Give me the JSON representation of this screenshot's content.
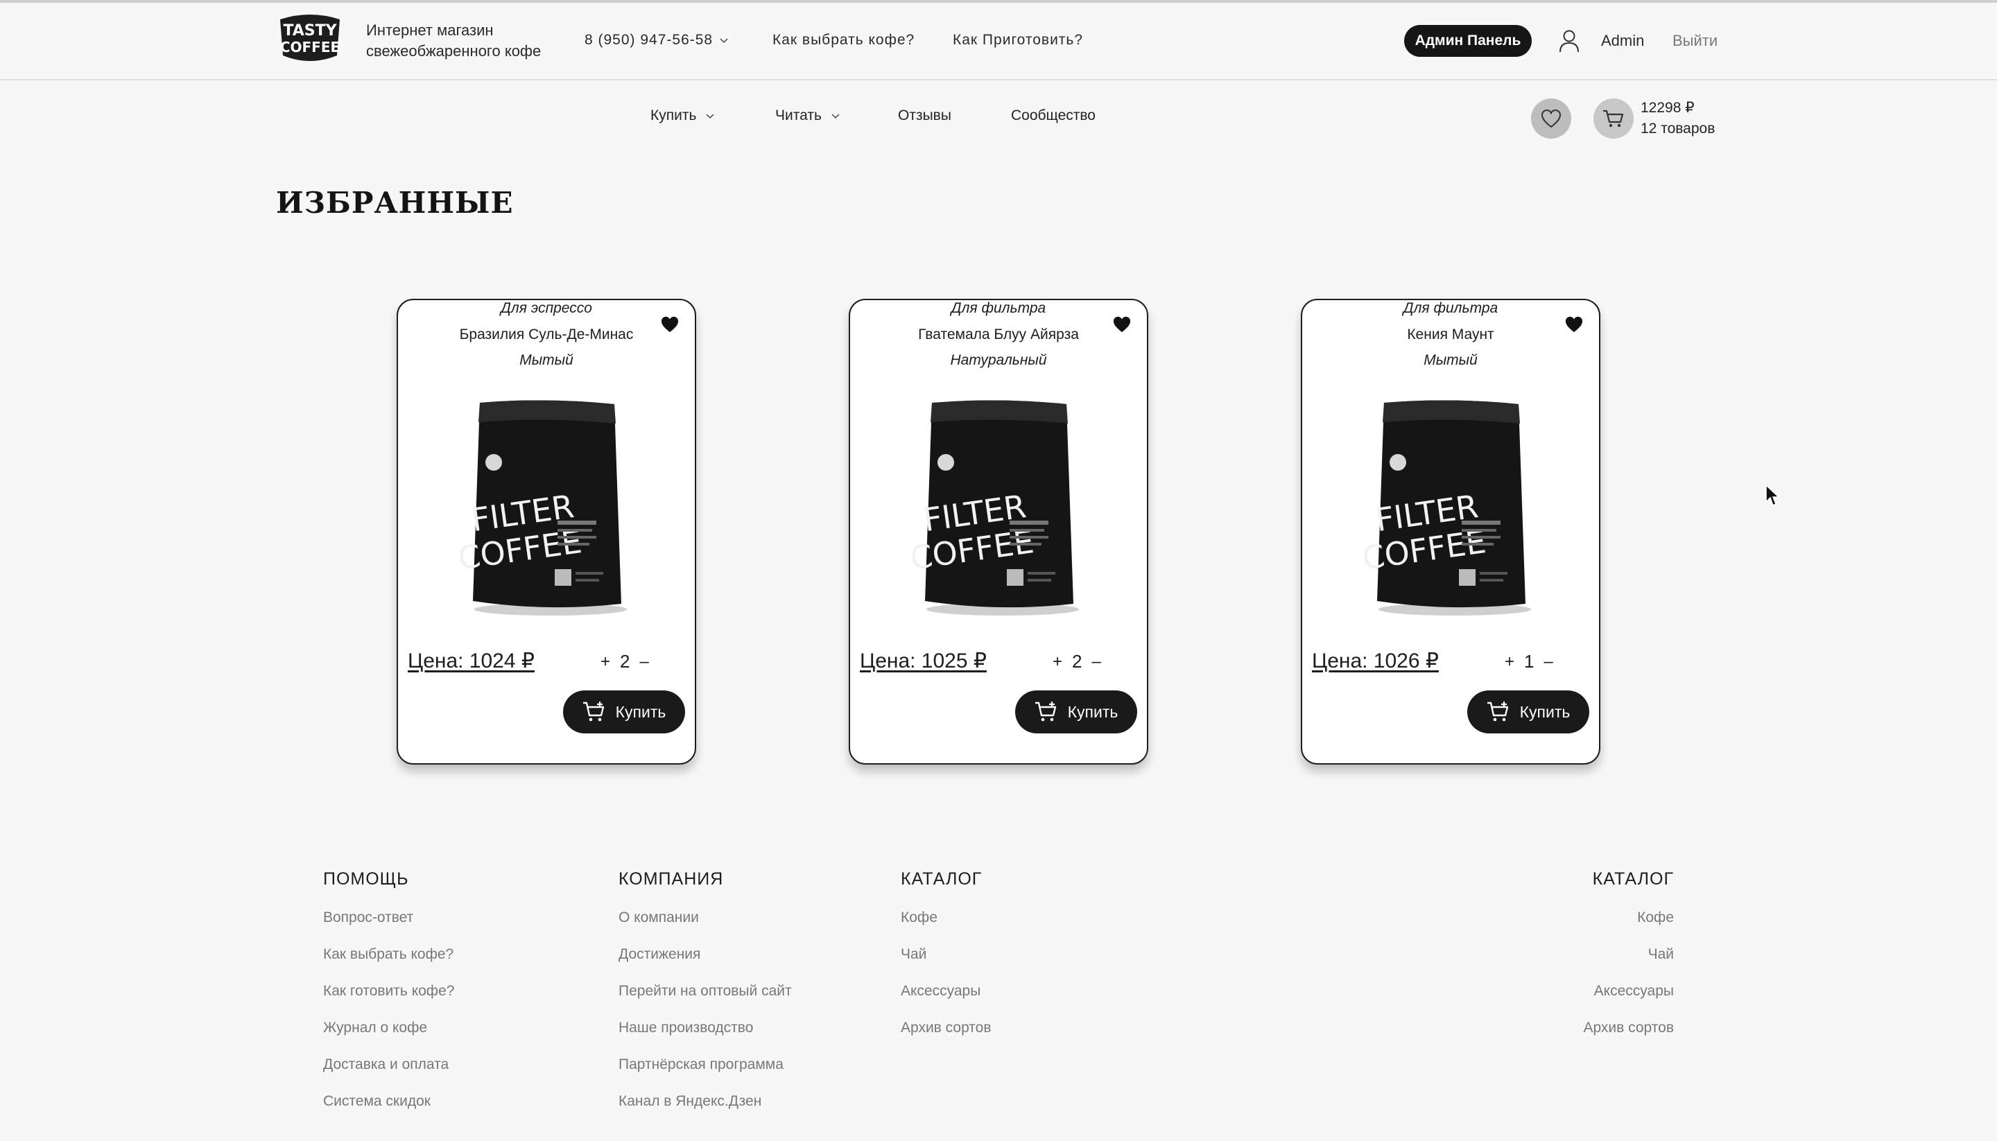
{
  "header": {
    "logo_line1": "TASTY",
    "logo_line2": "COFFEE",
    "tagline_line1": "Интернет магазин",
    "tagline_line2": "свежеобжаренного кофе",
    "phone": "8 (950) 947-56-58",
    "link_choose": "Как выбрать кофе?",
    "link_prepare": "Как Приготовить?",
    "admin_panel": "Админ Панель",
    "user_name": "Admin",
    "logout": "Выйти"
  },
  "nav": {
    "buy": "Купить",
    "read": "Читать",
    "reviews": "Отзывы",
    "community": "Сообщество",
    "cart_total": "12298 ₽",
    "cart_count": "12 товаров"
  },
  "page": {
    "title": "ИЗБРАННЫЕ"
  },
  "products": [
    {
      "category": "Для эспрессо",
      "name": "Бразилия Суль-Де-Минас",
      "process": "Мытый",
      "price": "Цена: 1024 ₽",
      "qty": "2",
      "buy": "Купить"
    },
    {
      "category": "Для фильтра",
      "name": "Гватемала Блуу Айярза",
      "process": "Натуральный",
      "price": "Цена: 1025 ₽",
      "qty": "2",
      "buy": "Купить"
    },
    {
      "category": "Для фильтра",
      "name": "Кения Маунт",
      "process": "Мытый",
      "price": "Цена: 1026 ₽",
      "qty": "1",
      "buy": "Купить"
    }
  ],
  "bag_text": {
    "line1": "FILTER",
    "line2": "COFFEE"
  },
  "qty_plus": "+",
  "qty_minus": "–",
  "footer": {
    "help": {
      "title": "ПОМОЩЬ",
      "links": [
        "Вопрос-ответ",
        "Как выбрать кофе?",
        "Как готовить кофе?",
        "Журнал о кофе",
        "Доставка и оплата",
        "Система скидок"
      ]
    },
    "company": {
      "title": "КОМПАНИЯ",
      "links": [
        "О компании",
        "Достижения",
        "Перейти на оптовый сайт",
        "Наше производство",
        "Партнёрская программа",
        "Канал в Яндекс.Дзен"
      ]
    },
    "catalog": {
      "title": "КАТАЛОГ",
      "links": [
        "Кофе",
        "Чай",
        "Аксессуары",
        "Архив сортов"
      ]
    },
    "catalog_right": {
      "title": "КАТАЛОГ",
      "links": [
        "Кофе",
        "Чай",
        "Аксессуары",
        "Архив сортов"
      ]
    }
  },
  "icons": {
    "logo": "tasty-coffee-logo",
    "user": "user-icon",
    "heart": "heart-icon",
    "cart": "cart-icon",
    "chevron": "chevron-down-icon"
  },
  "colors": {
    "background": "#f7f7f7",
    "dark": "#161616",
    "muted": "#777777"
  }
}
